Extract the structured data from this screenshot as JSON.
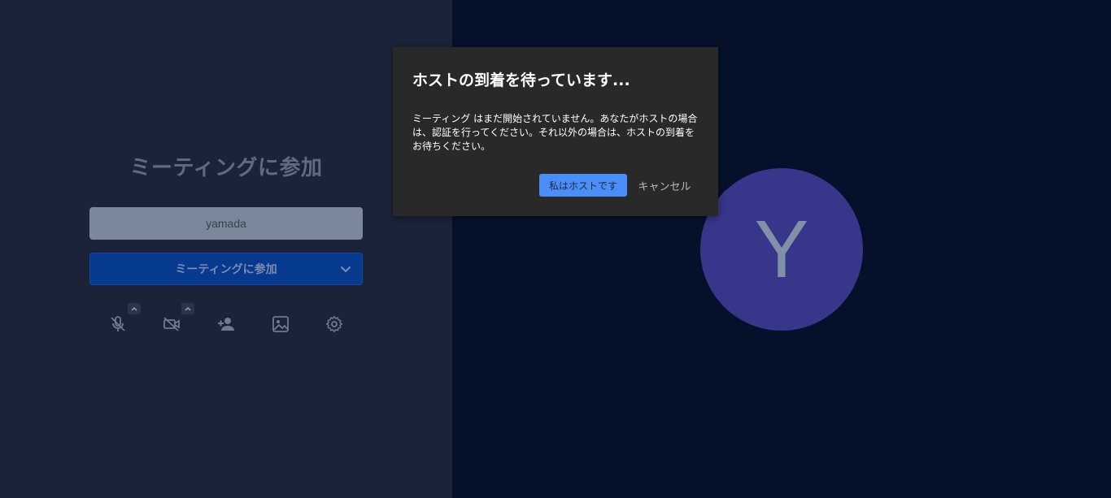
{
  "prejoin": {
    "title": "ミーティングに参加",
    "name_value": "yamada",
    "join_button_label": "ミーティングに参加"
  },
  "toolbar": {
    "icons": [
      "mic-off-icon",
      "video-off-icon",
      "invite-icon",
      "background-icon",
      "settings-icon"
    ]
  },
  "avatar": {
    "initial": "Y",
    "color": "#37368a"
  },
  "dialog": {
    "title": "ホストの到着を待っています...",
    "body": "ミーティング はまだ開始されていません。あなたがホストの場合は、認証を行ってください。それ以外の場合は、ホストの到着をお待ちください。",
    "host_button_label": "私はホストです",
    "cancel_button_label": "キャンセル"
  },
  "colors": {
    "left_panel_bg": "#1a2338",
    "right_panel_bg": "#05112a",
    "dialog_bg": "#292929",
    "primary_button": "#4c8ef7"
  }
}
